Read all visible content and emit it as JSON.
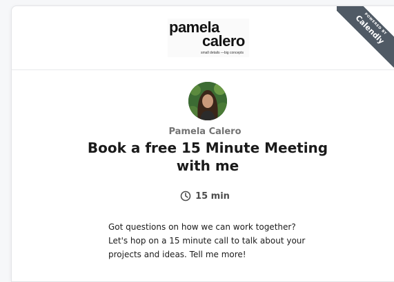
{
  "logo": {
    "line1": "pamela",
    "line2": "calero",
    "tagline": "small details —big concepts"
  },
  "badge": {
    "small_text": "POWERED BY",
    "brand": "Calendly"
  },
  "event": {
    "owner_name": "Pamela Calero",
    "title": "Book a free 15 Minute Meeting with me",
    "duration": "15 min",
    "description_lines": [
      "Got questions on how we can work together?",
      "Let's hop on a 15 minute call to talk about your",
      "projects and ideas. Tell me more!"
    ]
  },
  "icons": {
    "duration": "clock-icon"
  },
  "colors": {
    "badge_background": "#505a65",
    "title_text": "#1a1a1a",
    "muted_text": "#737373"
  }
}
